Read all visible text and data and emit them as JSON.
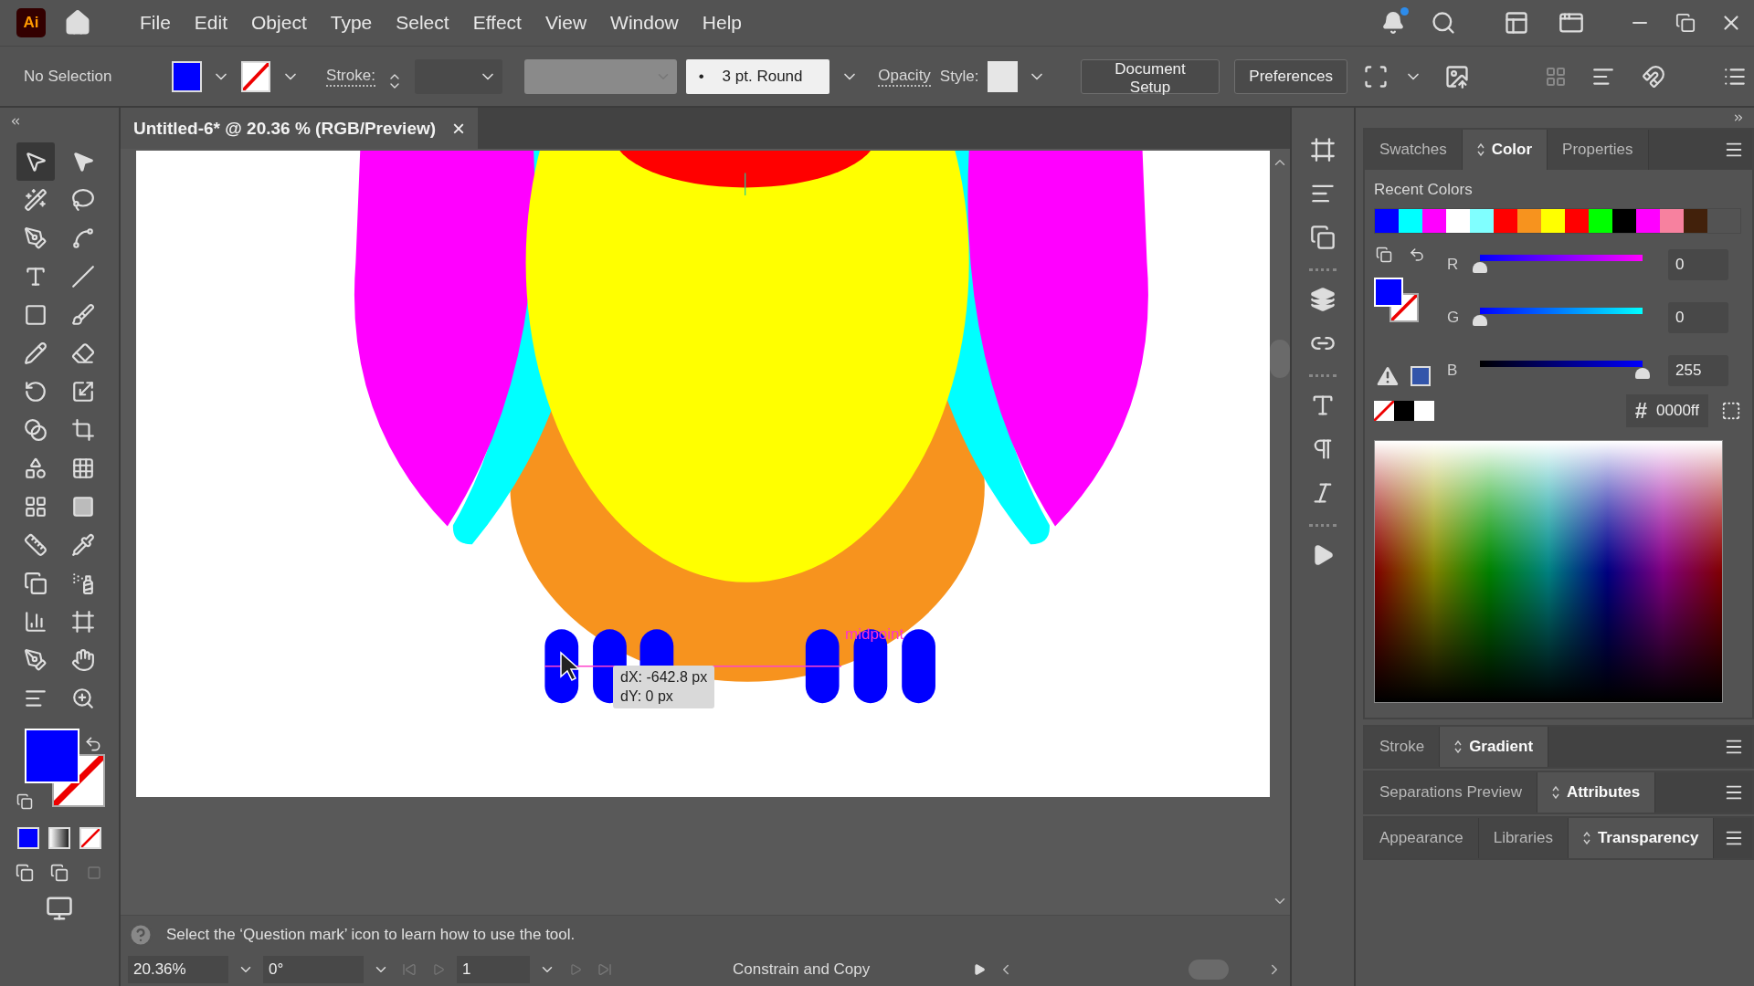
{
  "app_logo": "Ai",
  "menu_bar": {
    "items": [
      "File",
      "Edit",
      "Object",
      "Type",
      "Select",
      "Effect",
      "View",
      "Window",
      "Help"
    ]
  },
  "control_bar": {
    "selection_label": "No Selection",
    "stroke_label": "Stroke:",
    "brush_marker": "•",
    "brush": "3 pt. Round",
    "opacity_label": "Opacity",
    "style_label": "Style:",
    "buttons": [
      "Document Setup",
      "Preferences"
    ]
  },
  "document_tab": {
    "title": "Untitled-6* @ 20.36 % (RGB/Preview)",
    "close": "×"
  },
  "canvas": {
    "tooltip": [
      "dX: -642.8 px",
      "dY: 0 px"
    ],
    "smart_guide_label": "midpoint"
  },
  "hint": "Select the ‘Question mark’ icon to learn how to use the tool.",
  "status_bar": {
    "zoom": "20.36%",
    "rotation": "0°",
    "artboard": "1",
    "tool": "Constrain and Copy"
  },
  "color_panel": {
    "tabs": [
      {
        "label": "Swatches",
        "selected": false
      },
      {
        "label": "Color",
        "selected": true
      },
      {
        "label": "Properties",
        "selected": false
      }
    ],
    "recent_colors_label": "Recent Colors",
    "recent_colors": [
      {
        "color": "#0000ff"
      },
      {
        "color": "#00ffff"
      },
      {
        "color": "#ff00ff"
      },
      {
        "color": "#ffffff"
      },
      {
        "color": "#80ffff"
      },
      {
        "color": "#ff0000"
      },
      {
        "color": "#f7931e"
      },
      {
        "color": "#ffff00"
      },
      {
        "color": "#ff0000"
      },
      {
        "color": "#00ff00"
      },
      {
        "color": "#000000"
      },
      {
        "color": "#ff00ff"
      },
      {
        "color": "#f7819f"
      },
      {
        "color": "#42210b"
      }
    ],
    "channels": [
      {
        "name": "R",
        "level": 0,
        "value": "0"
      },
      {
        "name": "G",
        "level": 0,
        "value": "0"
      },
      {
        "name": "B",
        "level": 1,
        "value": "255"
      }
    ],
    "hash": "#",
    "hex": "0000ff"
  },
  "panel_groups": [
    {
      "tabs": [
        {
          "label": "Stroke",
          "selected": false
        },
        {
          "label": "Gradient",
          "selected": true
        }
      ]
    },
    {
      "tabs": [
        {
          "label": "Separations Preview",
          "selected": false
        },
        {
          "label": "Attributes",
          "selected": true
        }
      ]
    },
    {
      "tabs": [
        {
          "label": "Appearance",
          "selected": false
        },
        {
          "label": "Libraries",
          "selected": false
        },
        {
          "label": "Transparency",
          "selected": true
        }
      ]
    }
  ]
}
